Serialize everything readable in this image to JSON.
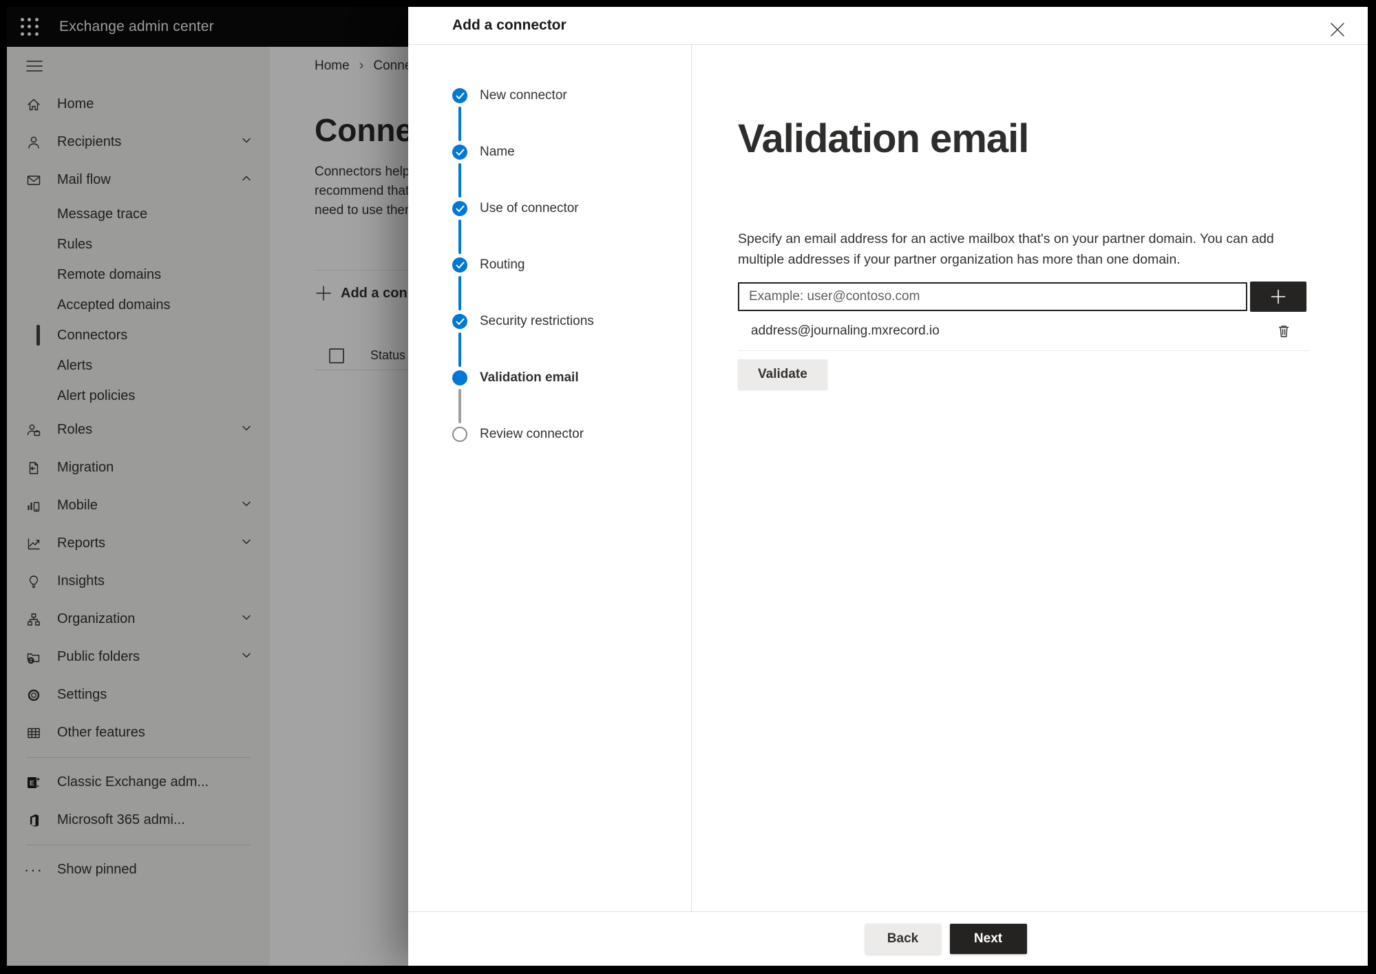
{
  "colors": {
    "accent": "#0078d4",
    "topbar_bg": "#0a0a0a",
    "sidebar_bg": "#f3f2f1",
    "overlay": "rgba(0,0,0,0.36)",
    "divider": "#e1dfdd",
    "gray_button_bg": "#edebe9",
    "dark_button_bg": "#242322",
    "step_upcoming_border": "#8a8886"
  },
  "topbar": {
    "title": "Exchange admin center",
    "waffle_icon": "waffle-icon"
  },
  "sidebar": {
    "hamburger_icon": "hamburger-icon",
    "primary": [
      {
        "label": "Home",
        "icon": "home-icon"
      },
      {
        "label": "Recipients",
        "icon": "person-icon",
        "chevron": "down"
      },
      {
        "label": "Mail flow",
        "icon": "mail-icon",
        "chevron": "up",
        "expanded": true
      }
    ],
    "mail_flow_children": [
      {
        "label": "Message trace",
        "selected": false
      },
      {
        "label": "Rules",
        "selected": false
      },
      {
        "label": "Remote domains",
        "selected": false
      },
      {
        "label": "Accepted domains",
        "selected": false
      },
      {
        "label": "Connectors",
        "selected": true
      },
      {
        "label": "Alerts",
        "selected": false
      },
      {
        "label": "Alert policies",
        "selected": false
      }
    ],
    "secondary": [
      {
        "label": "Roles",
        "icon": "roles-icon",
        "chevron": "down"
      },
      {
        "label": "Migration",
        "icon": "migration-icon"
      },
      {
        "label": "Mobile",
        "icon": "mobile-icon",
        "chevron": "down"
      },
      {
        "label": "Reports",
        "icon": "reports-icon",
        "chevron": "down"
      },
      {
        "label": "Insights",
        "icon": "insights-icon"
      },
      {
        "label": "Organization",
        "icon": "organization-icon",
        "chevron": "down"
      },
      {
        "label": "Public folders",
        "icon": "public-folders-icon",
        "chevron": "down"
      },
      {
        "label": "Settings",
        "icon": "settings-icon"
      },
      {
        "label": "Other features",
        "icon": "other-features-icon"
      }
    ],
    "footer": [
      {
        "label": "Classic Exchange adm...",
        "icon": "classic-exchange-icon"
      },
      {
        "label": "Microsoft 365 admi...",
        "icon": "microsoft-365-icon"
      }
    ],
    "show_pinned": {
      "label": "Show pinned",
      "icon": "ellipsis-icon"
    }
  },
  "background_page": {
    "breadcrumb": {
      "home": "Home",
      "separator": "›",
      "current": "Conne"
    },
    "title": "Connec",
    "description_lines": [
      "Connectors help",
      "recommend that",
      "need to use ther"
    ],
    "add_connector_button": "Add a conn",
    "table": {
      "status_header": "Status"
    }
  },
  "modal": {
    "title": "Add a connector",
    "close_icon": "close-icon",
    "steps": [
      {
        "label": "New connector",
        "state": "complete"
      },
      {
        "label": "Name",
        "state": "complete"
      },
      {
        "label": "Use of connector",
        "state": "complete"
      },
      {
        "label": "Routing",
        "state": "complete"
      },
      {
        "label": "Security restrictions",
        "state": "complete"
      },
      {
        "label": "Validation email",
        "state": "current"
      },
      {
        "label": "Review connector",
        "state": "upcoming"
      }
    ],
    "content": {
      "title": "Validation email",
      "description": "Specify an email address for an active mailbox that's on your partner domain. You can add multiple addresses if your partner organization has more than one domain.",
      "input_placeholder": "Example: user@contoso.com",
      "input_value": "",
      "add_button_icon": "plus-icon",
      "addresses": [
        {
          "email": "address@journaling.mxrecord.io",
          "delete_icon": "trash-icon"
        }
      ],
      "validate_button": "Validate"
    },
    "footer": {
      "back_button": "Back",
      "next_button": "Next"
    }
  }
}
